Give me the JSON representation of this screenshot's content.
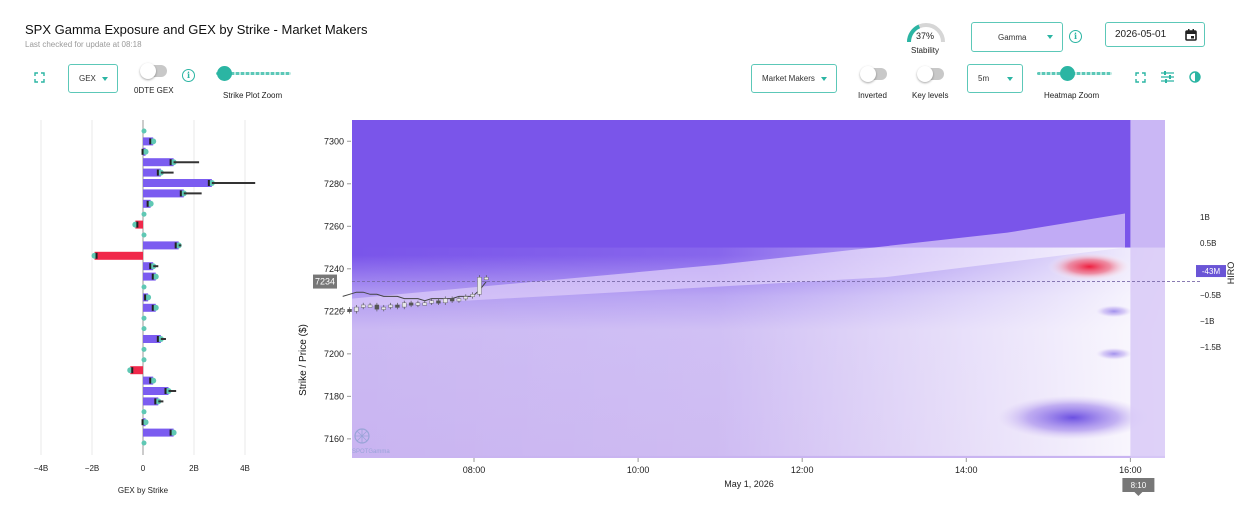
{
  "header": {
    "title": "SPX Gamma Exposure and GEX by Strike - Market Makers",
    "last_checked": "Last checked for update at 08:18"
  },
  "controls_left": {
    "gex_select": "GEX",
    "odte_label": "0DTE GEX",
    "strike_zoom_label": "Strike Plot Zoom",
    "strike_zoom_level": 0.1
  },
  "controls_right": {
    "stability_value": "37%",
    "stability_label": "Stability",
    "stability_fraction": 0.37,
    "greek_select": "Gamma",
    "date": "2026-05-01",
    "participant_select": "Market Makers",
    "inverted_label": "Inverted",
    "key_levels_label": "Key levels",
    "interval_select": "5m",
    "heatmap_zoom_label": "Heatmap Zoom",
    "heatmap_zoom_level": 0.4
  },
  "colors": {
    "accent": "#2bb5a3",
    "positive": "#7b5cf0",
    "negative": "#f0284a",
    "heat_purple": "#7a55ea",
    "heat_light": "#f5f0fb"
  },
  "chart_data": [
    {
      "type": "bar",
      "orientation": "horizontal",
      "xlabel": "GEX by Strike",
      "x_ticks": [
        "−4B",
        "−2B",
        "0",
        "2B",
        "4B"
      ],
      "xlim": [
        -4.5,
        4.5
      ],
      "strikes": [
        7305,
        7300,
        7295,
        7290,
        7285,
        7280,
        7275,
        7270,
        7265,
        7260,
        7255,
        7250,
        7245,
        7240,
        7235,
        7230,
        7225,
        7220,
        7215,
        7210,
        7205,
        7200,
        7195,
        7190,
        7185,
        7180,
        7175,
        7170,
        7165,
        7160,
        7155
      ],
      "values": [
        0.0,
        0.4,
        0.1,
        1.2,
        0.7,
        2.7,
        1.6,
        0.3,
        0.0,
        -0.3,
        0.0,
        1.4,
        -1.9,
        0.4,
        0.5,
        0.0,
        0.2,
        0.5,
        0.0,
        0.0,
        0.7,
        0.0,
        0.0,
        -0.5,
        0.4,
        1.0,
        0.6,
        0.0,
        0.1,
        1.2,
        0.0
      ],
      "whisker": [
        0,
        0,
        0,
        2.2,
        1.2,
        4.4,
        2.3,
        0,
        0,
        0,
        0,
        1.5,
        -1.9,
        0.6,
        0,
        0,
        0,
        0,
        0,
        0,
        0.9,
        0,
        0,
        0,
        0,
        1.3,
        0.8,
        0,
        0,
        0,
        0
      ]
    },
    {
      "type": "heatmap",
      "ylabel": "Strike / Price ($)",
      "y_ticks": [
        "7300",
        "7280",
        "7260",
        "7240",
        "7220",
        "7200",
        "7180",
        "7160"
      ],
      "ylim": [
        7151,
        7310
      ],
      "x_ticks": [
        "08:00",
        "10:00",
        "12:00",
        "14:00",
        "16:00"
      ],
      "x_date": "May 1, 2026",
      "current_price_label": "7234",
      "current_price": 7234,
      "colorbar_ticks": [
        "1B",
        "0.5B",
        "0",
        "−0.5B",
        "−1B",
        "−1.5B"
      ],
      "colorbar_marker": "-43M",
      "colorbar_title": "HIRO",
      "time_cursor": "8:10",
      "watermark": "SPOTGamma",
      "price_series": [
        7221,
        7220,
        7222,
        7223,
        7223,
        7221,
        7222,
        7223,
        7222,
        7224,
        7223,
        7224,
        7224,
        7225,
        7224,
        7226,
        7225,
        7226,
        7227,
        7228,
        7236,
        7236
      ],
      "hiro_line": [
        7227,
        7228,
        7229,
        7229,
        7228,
        7228,
        7227,
        7227,
        7227,
        7226,
        7226,
        7226,
        7225,
        7226,
        7226,
        7226,
        7226,
        7227,
        7227,
        7227,
        7230,
        7234
      ]
    }
  ]
}
